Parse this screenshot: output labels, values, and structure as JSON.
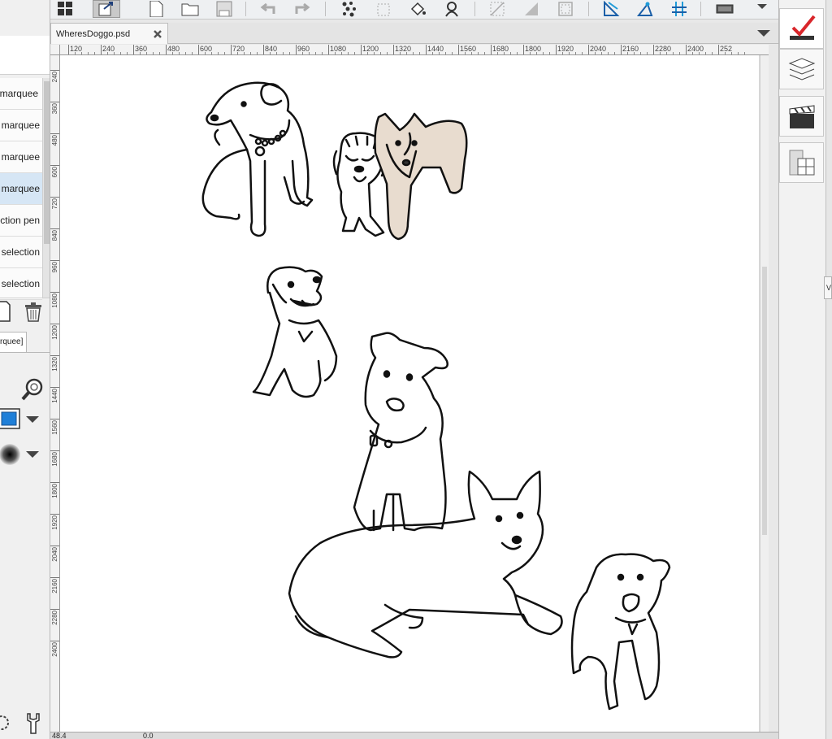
{
  "document": {
    "tab_title": "WheresDoggo.psd"
  },
  "tool_list": [
    {
      "label": "marquee",
      "selected": false,
      "has_zoom": true
    },
    {
      "label": "marquee",
      "selected": false,
      "has_zoom": false
    },
    {
      "label": "marquee",
      "selected": false,
      "has_zoom": false
    },
    {
      "label": "marquee",
      "selected": true,
      "has_zoom": false
    },
    {
      "label": "lection pen",
      "selected": false,
      "has_zoom": false
    },
    {
      "label": "selection",
      "selected": false,
      "has_zoom": false
    },
    {
      "label": "selection",
      "selected": false,
      "has_zoom": false
    }
  ],
  "left_panel": {
    "tab_label": "rquee]"
  },
  "ruler_h_labels": [
    "120",
    "240",
    "360",
    "480",
    "600",
    "720",
    "840",
    "960",
    "1080",
    "1200",
    "1320",
    "1440",
    "1560",
    "1680",
    "1800",
    "1920",
    "2040",
    "2160",
    "2280",
    "2400",
    "252"
  ],
  "ruler_v_labels": [
    "240",
    "360",
    "480",
    "600",
    "720",
    "840",
    "960",
    "1080",
    "1200",
    "1320",
    "1440",
    "1560",
    "1680",
    "1800",
    "1920",
    "2040",
    "2160",
    "2280",
    "2400"
  ],
  "status": {
    "x_readout": "48.4",
    "y_readout": "0.0"
  },
  "right_panel": {
    "mini_tab": "V"
  },
  "colors": {
    "accent_red": "#d9262b",
    "accent_blue": "#1f9bd8",
    "selection_blue": "#d6e6f5"
  }
}
